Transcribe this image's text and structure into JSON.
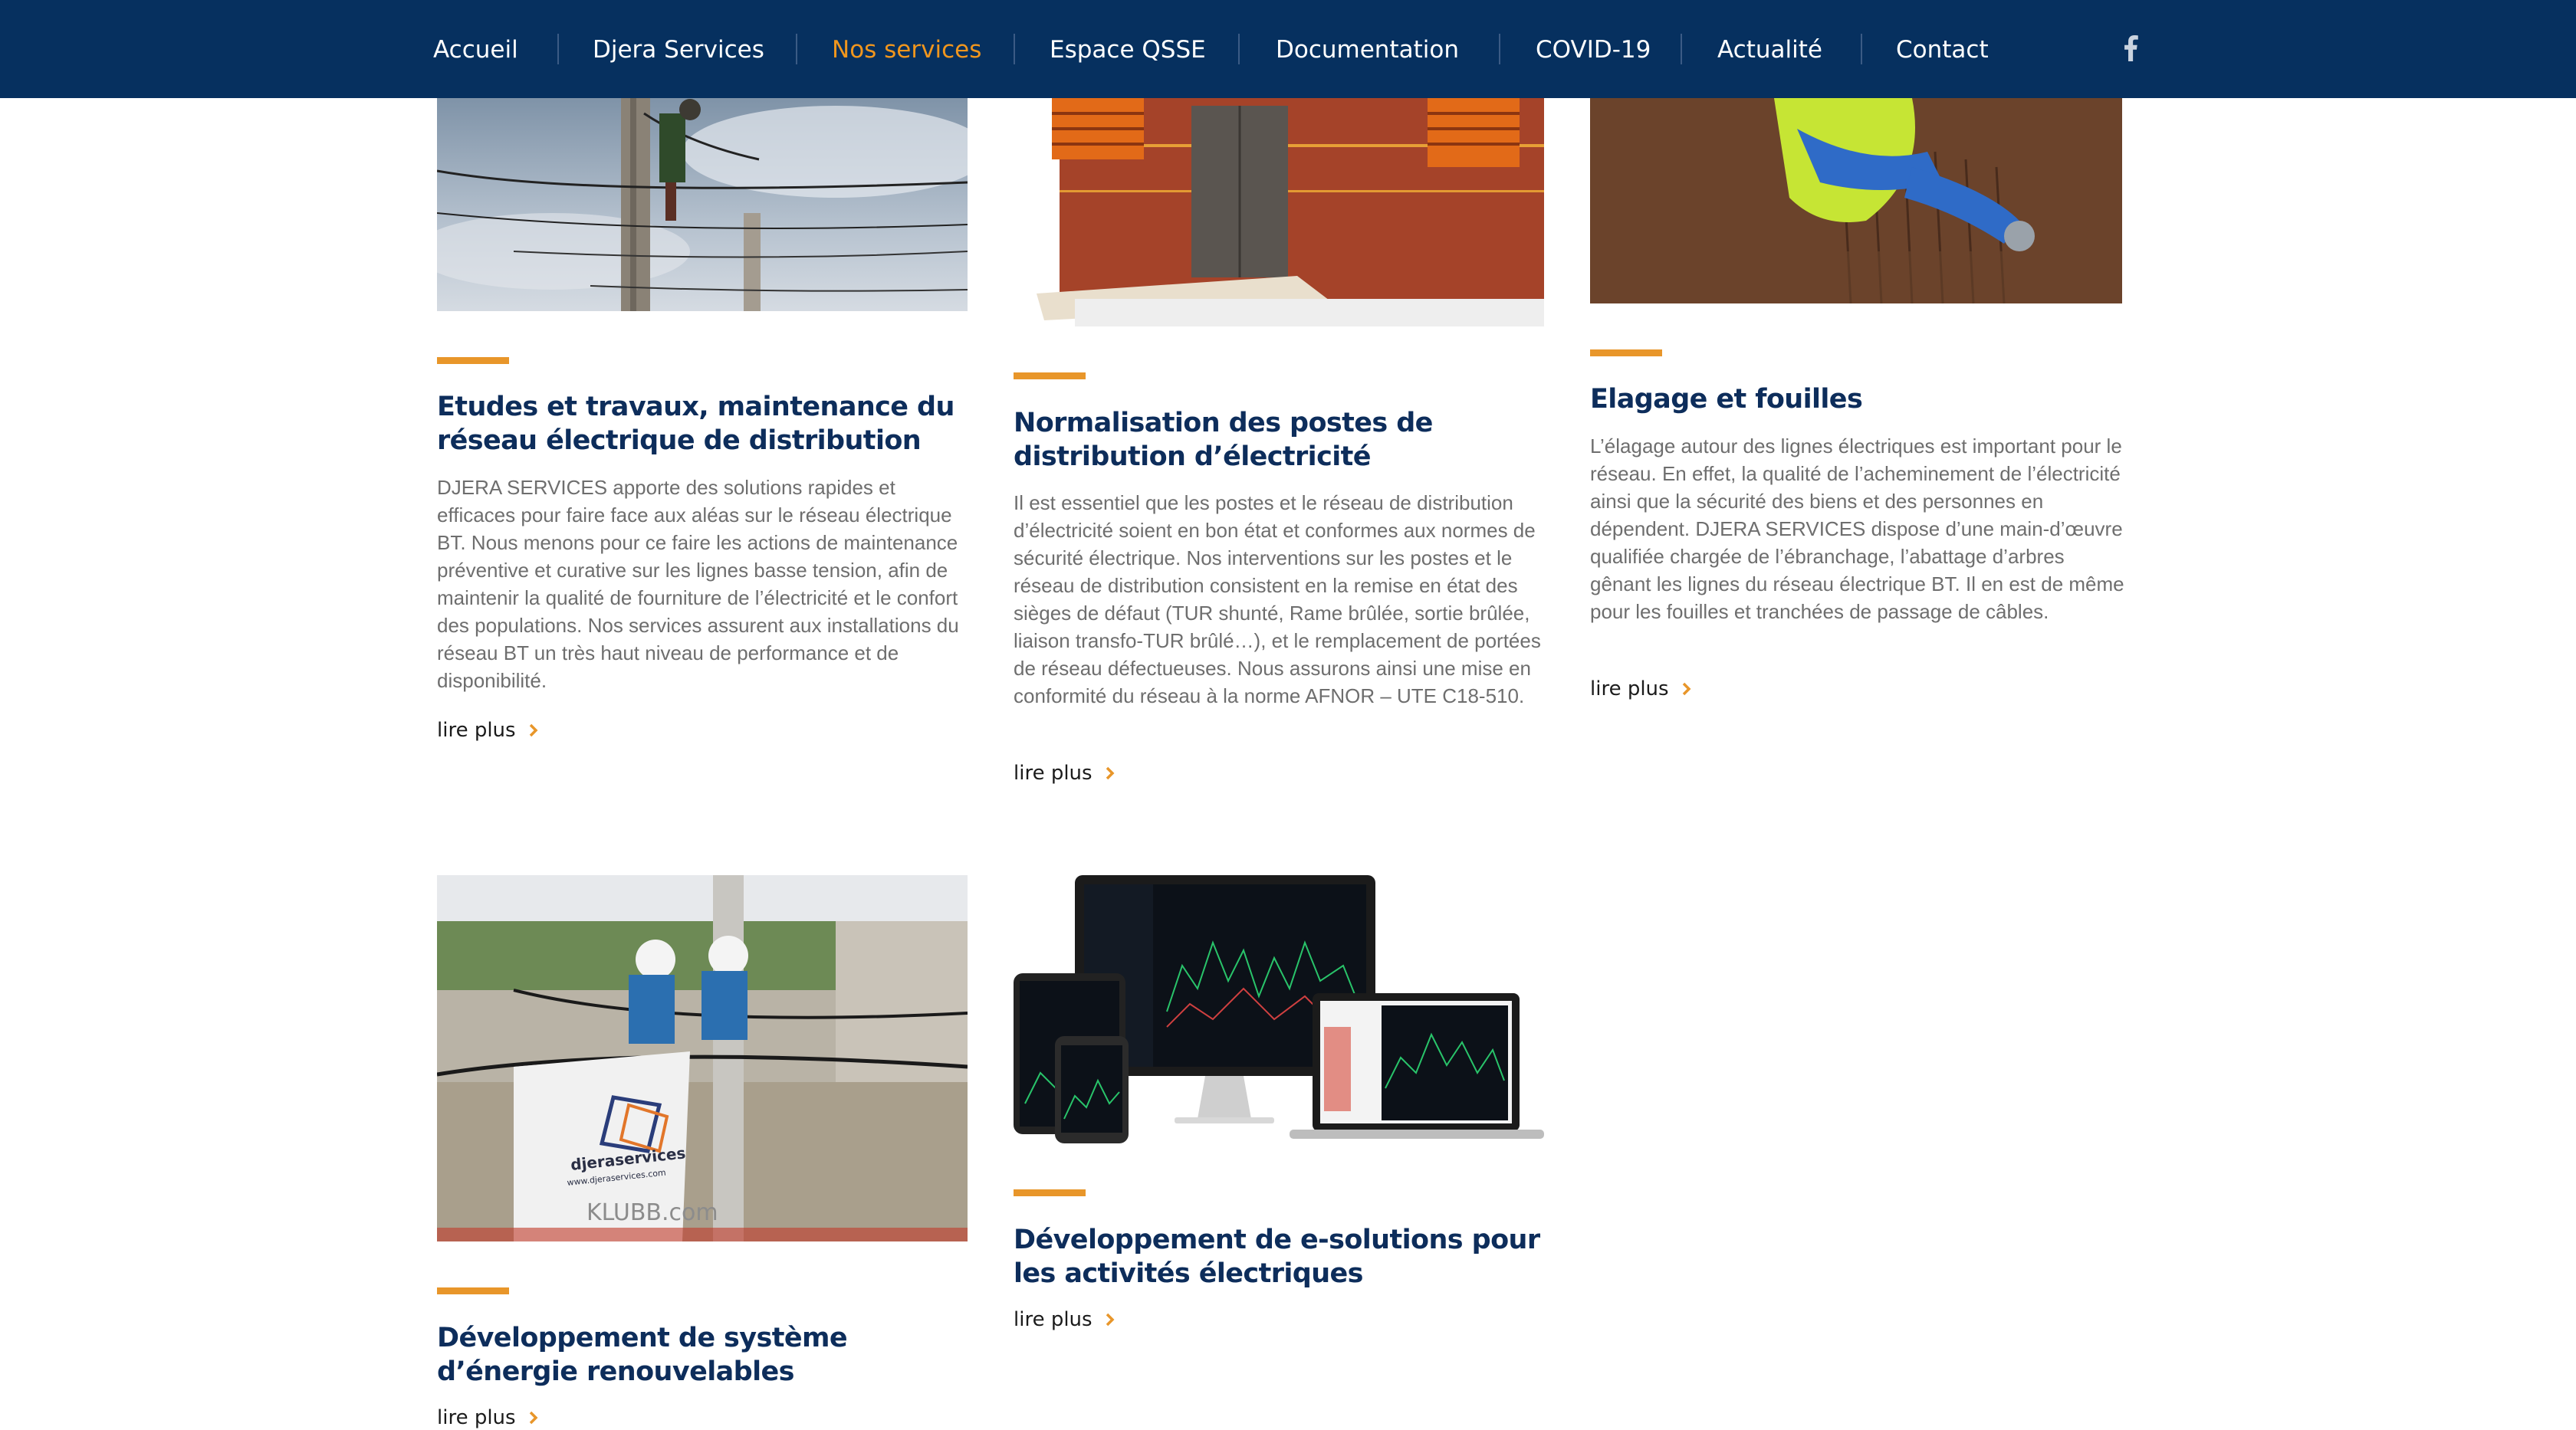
{
  "nav": {
    "items": [
      "Accueil",
      "Djera Services",
      "Nos services",
      "Espace QSSE",
      "Documentation",
      "COVID-19",
      "Actualité",
      "Contact"
    ],
    "active_index": 2,
    "social_icon": "facebook-icon"
  },
  "colors": {
    "nav_bg": "#06305f",
    "accent": "#e8962a",
    "title": "#0d2d5b",
    "body_text": "#6e6e6e"
  },
  "cards": [
    {
      "title": "Etudes et travaux, maintenance du réseau électrique de distribution",
      "text": "DJERA SERVICES apporte des solutions rapides et efficaces pour faire face aux aléas sur le réseau électrique BT. Nous menons pour ce faire les actions de maintenance préventive et curative sur les lignes basse tension, afin de maintenir la qualité de fourniture de l’électricité et le confort des populations. Nos services assurent aux installations du réseau BT un très haut niveau de performance et de disponibilité.",
      "link": "lire plus"
    },
    {
      "title": "Normalisation des postes de distribution d’électricité",
      "text": "Il est essentiel que les postes et le réseau de distribution d’électricité soient en bon état et conformes aux normes de sécurité électrique. Nos interventions sur les postes et le réseau de distribution consistent en la remise en état des sièges de défaut (TUR shunté, Rame brûlée, sortie brûlée, liaison transfo-TUR brûlé…), et le remplacement de portées de réseau défectueuses. Nous assurons ainsi une mise en conformité du réseau à la norme AFNOR – UTE C18-510.",
      "link": "lire plus"
    },
    {
      "title": "Elagage et fouilles",
      "text": "L’élagage autour des lignes électriques est important pour le réseau. En effet, la qualité de l’acheminement de l’électricité ainsi que la sécurité des biens et des personnes en dépendent. DJERA SERVICES dispose d’une main-d’œuvre qualifiée chargée de l’ébranchage, l’abattage d’arbres gênant les lignes du réseau électrique BT. Il en est de même pour les fouilles et tranchées de passage de câbles.",
      "link": "lire plus"
    },
    {
      "title": "Développement de système d’énergie renouvelables",
      "text": "",
      "link": "lire plus"
    },
    {
      "title": "Développement de e-solutions pour les activités électriques",
      "text": "",
      "link": "lire plus"
    }
  ],
  "image_text": {
    "truck_brand": "djeraservices",
    "truck_site": "www.djeraservices.com",
    "truck_lower": "KLUBB.com"
  }
}
